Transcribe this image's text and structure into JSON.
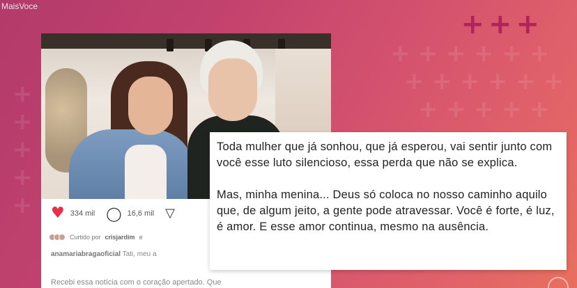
{
  "watermark": "MaisVoce",
  "post": {
    "likes": "334 mil",
    "comments": "16,6 mil",
    "liked_by_prefix": "Curtido por",
    "liked_by_user": "crisjardim",
    "liked_by_suffix": "e",
    "caption_user": "anamariabragaoficial",
    "caption_text": "Tati, meu a",
    "body_preview": "Recebi essa notícia com o coração apertado. Que"
  },
  "quote": {
    "paragraph1": "Toda mulher que já sonhou, que já esperou, vai sentir junto com você esse luto silencioso, essa perda que não se explica.",
    "paragraph2": "Mas, minha menina... Deus só coloca no nosso caminho aquilo que, de algum jeito, a gente pode atravessar. Você é forte, é luz, é amor. E esse amor continua, mesmo na ausência."
  },
  "icons": {
    "like": "heart-icon",
    "comment": "comment-icon",
    "share": "share-icon",
    "brand": "plus-logo-icon"
  },
  "colors": {
    "heart": "#e8304a",
    "brand_plus": "#b0245e",
    "background_start": "#b23a6a",
    "background_end": "#e8705f"
  }
}
